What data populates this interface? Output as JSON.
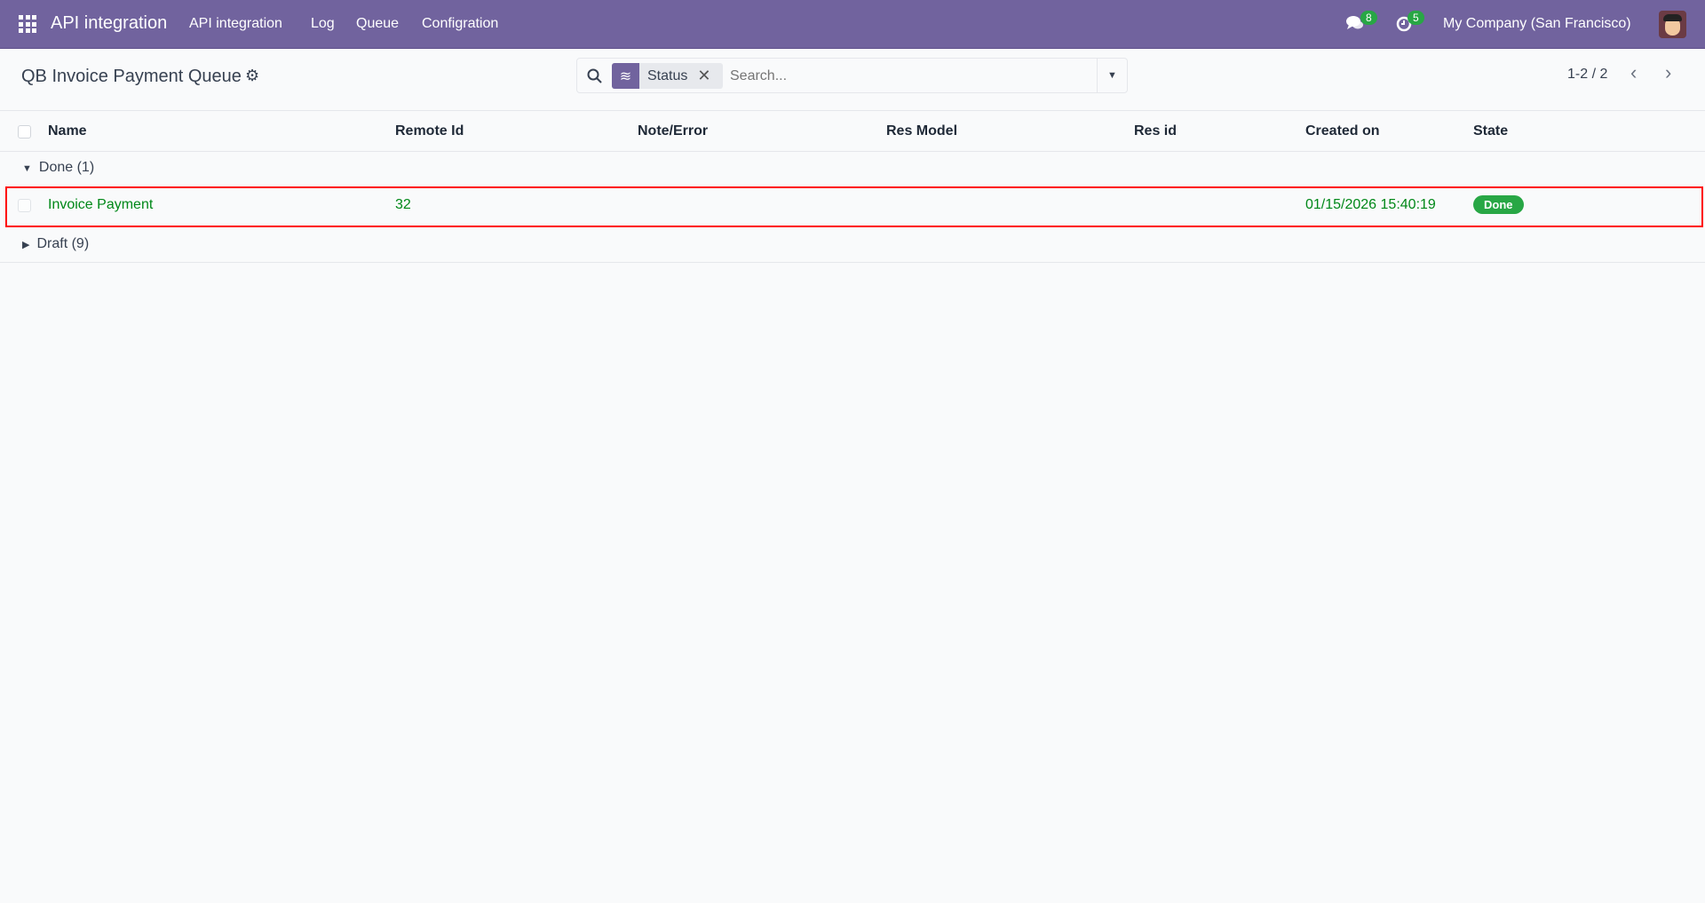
{
  "navbar": {
    "app_name": "API integration",
    "menu": [
      "API integration",
      "Log",
      "Queue",
      "Configration"
    ],
    "messages_count": "8",
    "activities_count": "5",
    "company": "My Company (San Francisco)"
  },
  "control_panel": {
    "title": "QB Invoice Payment Queue",
    "facet_label": "Status",
    "search_placeholder": "Search...",
    "pager": "1-2 / 2"
  },
  "table": {
    "columns": [
      "Name",
      "Remote Id",
      "Note/Error",
      "Res Model",
      "Res id",
      "Created on",
      "State"
    ],
    "groups": [
      {
        "label": "Done (1)",
        "expanded": true,
        "rows": [
          {
            "name": "Invoice Payment",
            "remote_id": "32",
            "note": "",
            "res_model": "",
            "res_id": "",
            "created_on": "01/15/2026 15:40:19",
            "state": "Done"
          }
        ]
      },
      {
        "label": "Draft (9)",
        "expanded": false
      }
    ]
  },
  "colors": {
    "navbar": "#71639e",
    "done_text": "#008818",
    "badge": "#28a745",
    "highlight": "#ff0000"
  }
}
